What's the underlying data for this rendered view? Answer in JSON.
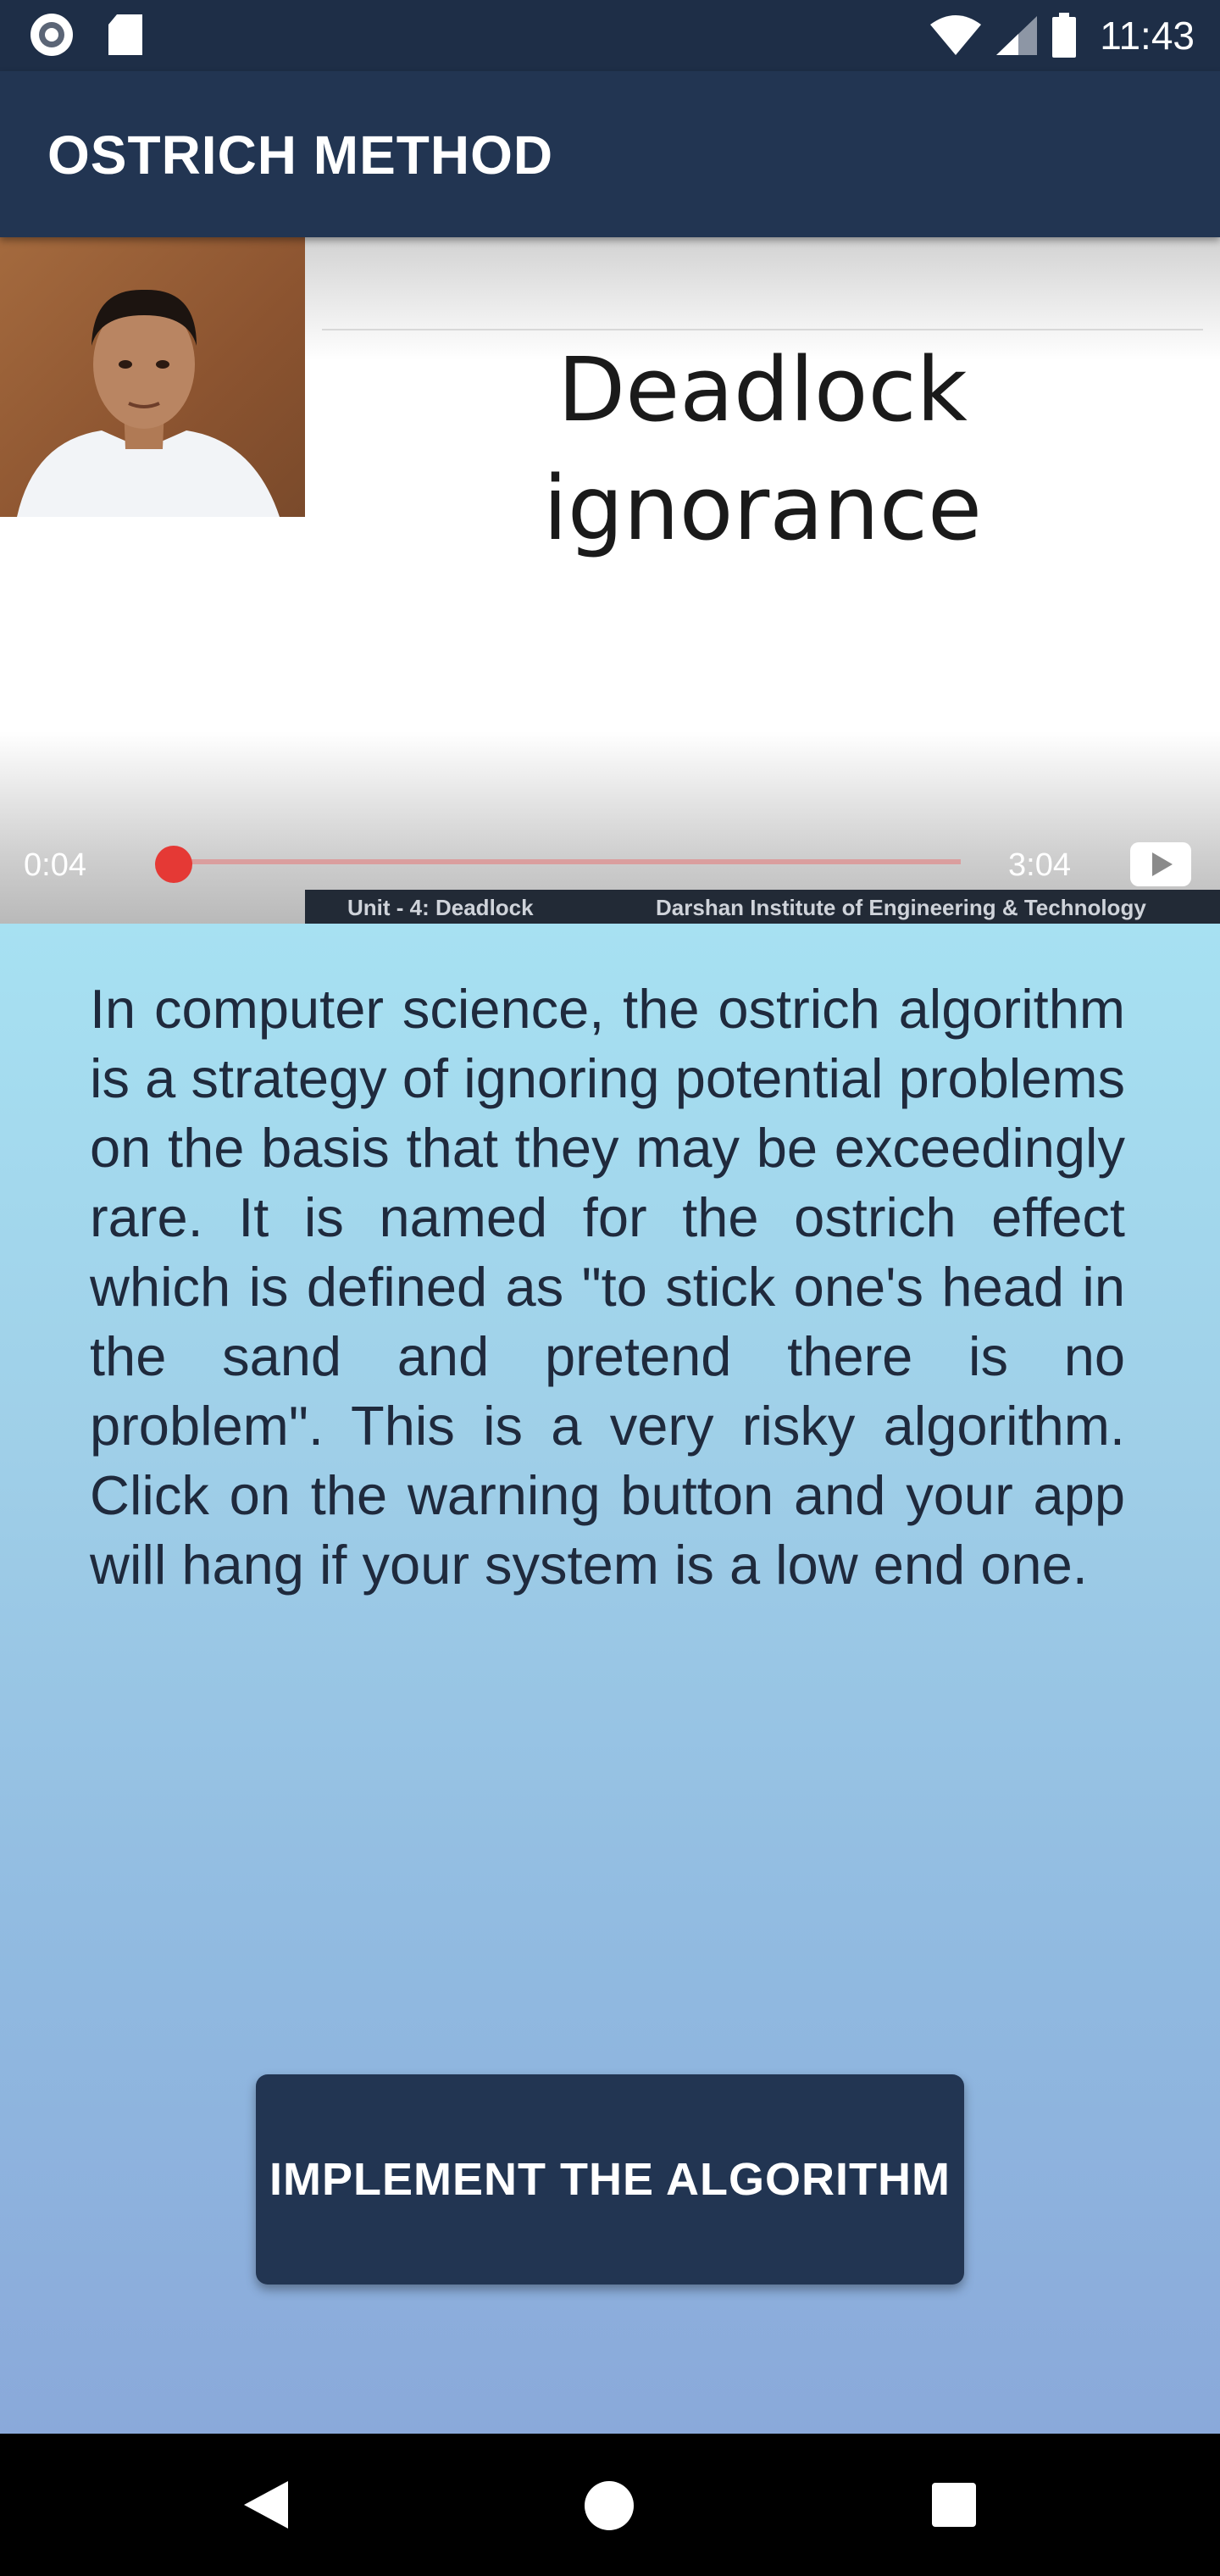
{
  "status_bar": {
    "time": "11:43",
    "icons": [
      "record-icon",
      "sd-card-icon",
      "wifi-icon",
      "signal-icon",
      "battery-icon"
    ]
  },
  "app_bar": {
    "title": "OSTRICH METHOD"
  },
  "video": {
    "slide_title_line1": "Deadlock",
    "slide_title_line2": "ignorance",
    "current_time": "0:04",
    "total_time": "3:04",
    "progress": 0.02,
    "caption_left": "Unit - 4: Deadlock",
    "caption_right": "Darshan Institute of Engineering & Technology"
  },
  "content": {
    "description": "In computer science, the ostrich algorithm is a strategy of ignoring potential problems on the basis that they may be exceedingly rare. It is named for the ostrich effect which is defined as \"to stick one's head in the sand and pretend there is no problem\". This is a very risky algorithm. Click on the warning button and your app will hang if your system is a low end one.",
    "button_label": "IMPLEMENT THE ALGORITHM"
  },
  "colors": {
    "app_bar": "#223552",
    "status_bar": "#1e2e47",
    "seek_accent": "#e53935",
    "button": "#223552"
  }
}
